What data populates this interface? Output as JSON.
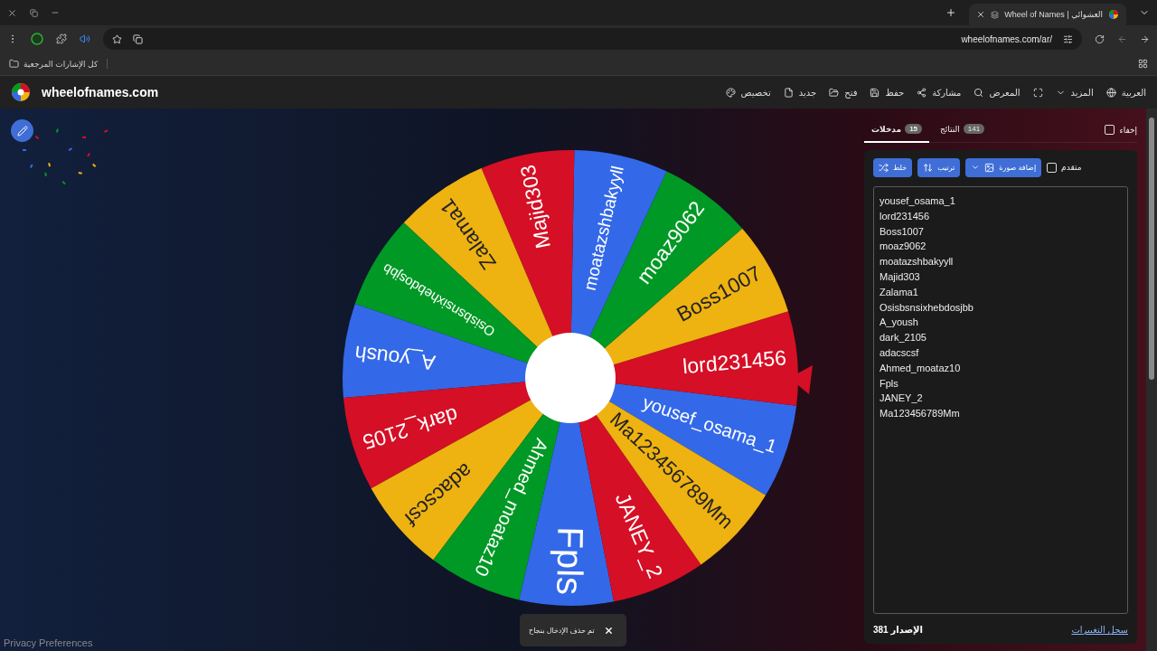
{
  "browser": {
    "tab": {
      "title": "Wheel of Names | العشوائي"
    },
    "address": "wheelofnames.com/ar/",
    "bookmarks_folder": "كل الإشارات المرجعية"
  },
  "header": {
    "logo": "wheelofnames.com",
    "menu": [
      {
        "kind": "language",
        "label": "العربية"
      },
      {
        "kind": "more",
        "label": "المزيد"
      },
      {
        "kind": "fullscreen"
      },
      {
        "kind": "gallery",
        "label": "المعرض"
      },
      {
        "kind": "share",
        "label": "مشاركة"
      },
      {
        "kind": "save",
        "label": "حفظ"
      },
      {
        "kind": "open",
        "label": "فتح"
      },
      {
        "kind": "new",
        "label": "جديد"
      },
      {
        "kind": "palette",
        "label": "تخصيص"
      }
    ]
  },
  "wheel": {
    "slices": [
      {
        "label": "yousef_osama_1",
        "color": "#3369e8"
      },
      {
        "label": "lord231456",
        "color": "#d50f25"
      },
      {
        "label": "Boss1007",
        "color": "#eeb211"
      },
      {
        "label": "moaz9062",
        "color": "#009925"
      },
      {
        "label": "moatazshbakyyll",
        "color": "#3369e8"
      },
      {
        "label": "Majid303",
        "color": "#d50f25"
      },
      {
        "label": "Zalama1",
        "color": "#eeb211"
      },
      {
        "label": "Osisbsnsixhebdosjbb",
        "color": "#009925"
      },
      {
        "label": "A_yoush",
        "color": "#3369e8"
      },
      {
        "label": "dark_2105",
        "color": "#d50f25"
      },
      {
        "label": "adacscsf",
        "color": "#eeb211"
      },
      {
        "label": "Ahmed_moataz10",
        "color": "#009925"
      },
      {
        "label": "Fpls",
        "color": "#3369e8"
      },
      {
        "label": "JANEY_2",
        "color": "#d50f25"
      },
      {
        "label": "Ma123456789Mm",
        "color": "#eeb211"
      }
    ]
  },
  "sidebar": {
    "hide": {
      "label": "إخفاء",
      "checked": false
    },
    "tabs": [
      {
        "label": "النتائج",
        "count": "141",
        "selected": false
      },
      {
        "label": "مدخلات",
        "count": "15",
        "selected": true
      }
    ],
    "toolbar": [
      {
        "kind": "image",
        "label": "إضافة صورة"
      },
      {
        "kind": "sort",
        "label": "ترتيب"
      },
      {
        "kind": "shuffle",
        "label": "خلط"
      }
    ],
    "advanced": {
      "label": "متقدم",
      "checked": false
    },
    "entries": [
      "yousef_osama_1",
      "lord231456",
      "Boss1007",
      "moaz9062",
      "moatazshbakyyll",
      "Majid303",
      "Zalama1",
      "Osisbsnsixhebdosjbb",
      "A_yoush",
      "dark_2105",
      "adacscsf",
      "Ahmed_moataz10",
      "Fpls",
      "JANEY_2",
      "Ma123456789Mm"
    ],
    "version": "الإصدار 381",
    "changelog": "سجل التغييرات"
  },
  "toast": {
    "message": "تم حذف الإدخال بنجاح"
  },
  "privacy": "Privacy Preferences"
}
